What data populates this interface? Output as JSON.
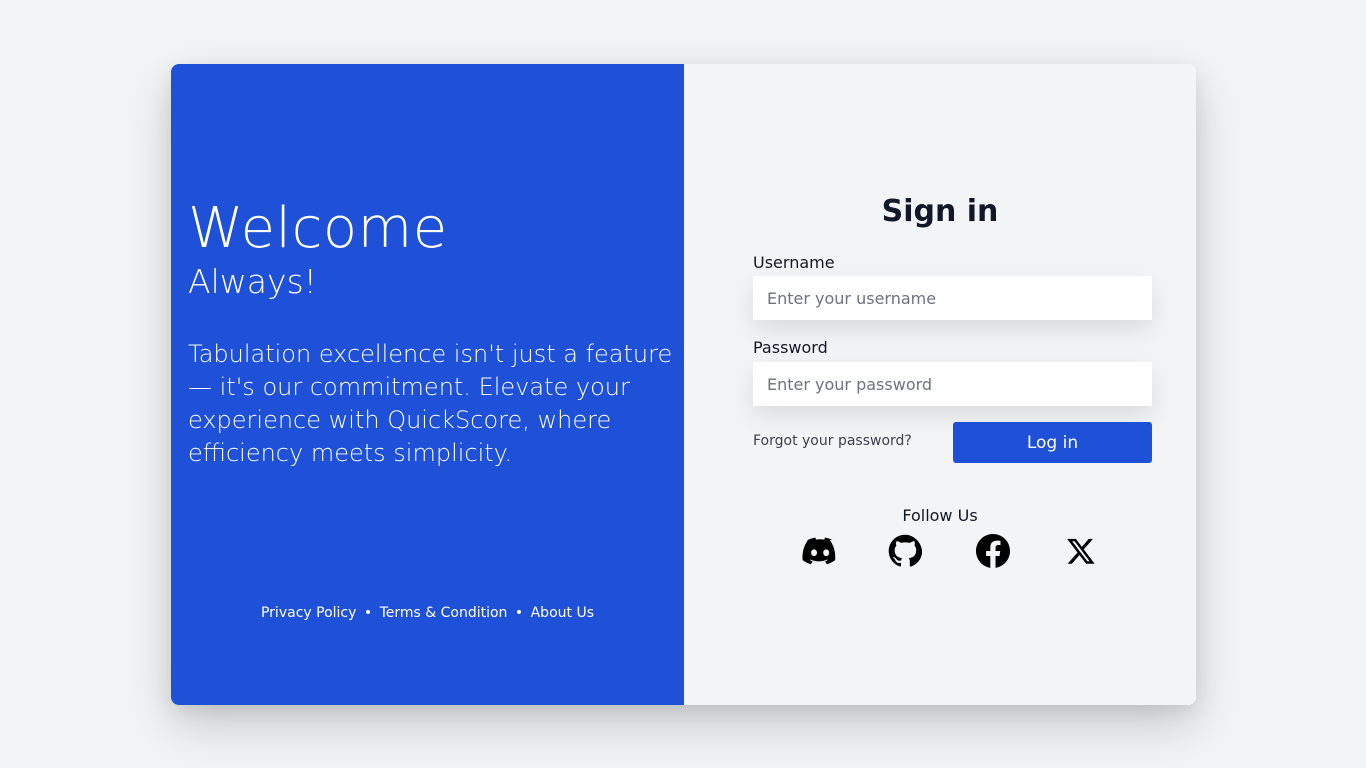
{
  "welcome": {
    "title": "Welcome",
    "subtitle": "Always!",
    "tagline": "Tabulation excellence isn't just a feature — it's our commitment. Elevate your experience with QuickScore, where efficiency meets simplicity."
  },
  "footer": {
    "privacy": "Privacy Policy",
    "terms": "Terms & Condition",
    "about": "About Us",
    "separator": "•"
  },
  "signin": {
    "title": "Sign in",
    "username_label": "Username",
    "username_placeholder": "Enter your username",
    "username_value": "",
    "password_label": "Password",
    "password_placeholder": "Enter your password",
    "password_value": "",
    "forgot": "Forgot your password?",
    "login": "Log in"
  },
  "follow": {
    "label": "Follow Us",
    "icons": [
      "discord-icon",
      "github-icon",
      "facebook-icon",
      "x-icon"
    ]
  },
  "colors": {
    "brand": "#1e50d8",
    "background": "#f3f4f6",
    "text": "#111827"
  }
}
